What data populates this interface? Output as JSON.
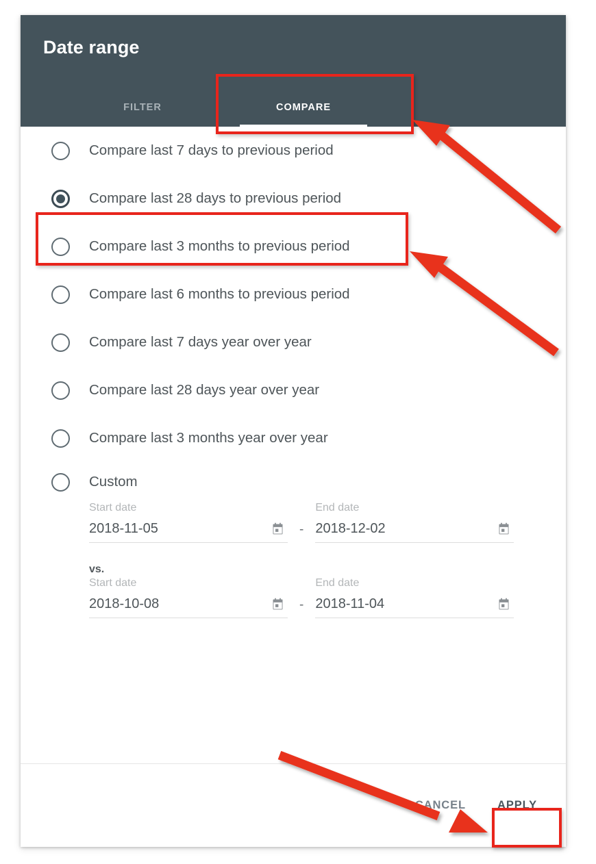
{
  "dialog": {
    "title": "Date range",
    "tabs": [
      {
        "id": "filter",
        "label": "FILTER",
        "selected": false
      },
      {
        "id": "compare",
        "label": "COMPARE",
        "selected": true
      }
    ]
  },
  "options": [
    {
      "label": "Compare last 7 days to previous period",
      "selected": false
    },
    {
      "label": "Compare last 28 days to previous period",
      "selected": true
    },
    {
      "label": "Compare last 3 months to previous period",
      "selected": false
    },
    {
      "label": "Compare last 6 months to previous period",
      "selected": false
    },
    {
      "label": "Compare last 7 days year over year",
      "selected": false
    },
    {
      "label": "Compare last 28 days year over year",
      "selected": false
    },
    {
      "label": "Compare last 3 months year over year",
      "selected": false
    },
    {
      "label": "Custom",
      "selected": false
    }
  ],
  "custom": {
    "primary": {
      "start_caption": "Start date",
      "start_value": "2018-11-05",
      "separator": "-",
      "end_caption": "End date",
      "end_value": "2018-12-02"
    },
    "vs_label": "vs.",
    "comparison": {
      "start_caption": "Start date",
      "start_value": "2018-10-08",
      "separator": "-",
      "end_caption": "End date",
      "end_value": "2018-11-04"
    },
    "calendar_icon": "calendar-icon"
  },
  "footer": {
    "cancel_label": "CANCEL",
    "apply_label": "APPLY"
  },
  "annotation": {
    "highlight_color": "#e8251c",
    "arrow_color": "#e8331f",
    "boxes": [
      "compare-tab",
      "compare-last-28-days-option",
      "apply-button"
    ],
    "arrows": [
      "arrow-to-compare-tab",
      "arrow-to-selected-option",
      "arrow-to-apply-button"
    ]
  },
  "colors": {
    "header_bg": "#44535b",
    "dialog_bg": "#ffffff",
    "text": "#4e5559",
    "muted_text": "#b3b6b8",
    "radio": "#5f6b72"
  }
}
